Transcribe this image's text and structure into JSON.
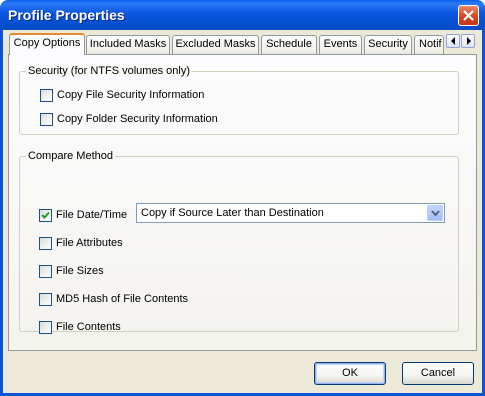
{
  "window": {
    "title": "Profile Properties"
  },
  "tabs": [
    {
      "label": "Copy Options",
      "active": true
    },
    {
      "label": "Included Masks",
      "active": false
    },
    {
      "label": "Excluded Masks",
      "active": false
    },
    {
      "label": "Schedule",
      "active": false
    },
    {
      "label": "Events",
      "active": false
    },
    {
      "label": "Security",
      "active": false
    },
    {
      "label": "Notif",
      "active": false
    }
  ],
  "security_group": {
    "label": "Security (for NTFS volumes only)",
    "options": [
      {
        "label": "Copy File Security Information",
        "checked": false
      },
      {
        "label": "Copy Folder Security Information",
        "checked": false
      }
    ]
  },
  "compare_group": {
    "label": "Compare Method",
    "options": [
      {
        "label": "File Date/Time",
        "checked": true
      },
      {
        "label": "File Attributes",
        "checked": false
      },
      {
        "label": "File Sizes",
        "checked": false
      },
      {
        "label": "MD5 Hash of File Contents",
        "checked": false
      },
      {
        "label": "File Contents",
        "checked": false
      }
    ],
    "date_time_mode": {
      "selected": "Copy if Source Later than Destination"
    }
  },
  "buttons": {
    "ok": "OK",
    "cancel": "Cancel"
  },
  "colors": {
    "titlebar": "#0a55df",
    "dialog_face": "#ece9d8",
    "active_tab_accent": "#e68b2c",
    "close_button": "#cf4220",
    "check_mark": "#21a121"
  }
}
